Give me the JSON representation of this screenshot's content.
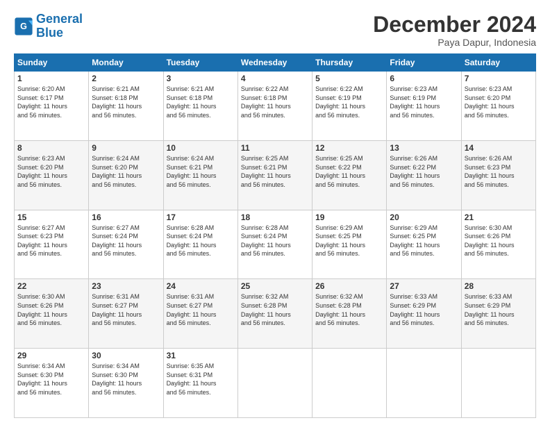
{
  "logo": {
    "line1": "General",
    "line2": "Blue"
  },
  "title": "December 2024",
  "subtitle": "Paya Dapur, Indonesia",
  "days_of_week": [
    "Sunday",
    "Monday",
    "Tuesday",
    "Wednesday",
    "Thursday",
    "Friday",
    "Saturday"
  ],
  "weeks": [
    [
      {
        "day": 1,
        "sunrise": "6:20 AM",
        "sunset": "6:17 PM",
        "daylight": "11 hours and 56 minutes."
      },
      {
        "day": 2,
        "sunrise": "6:21 AM",
        "sunset": "6:18 PM",
        "daylight": "11 hours and 56 minutes."
      },
      {
        "day": 3,
        "sunrise": "6:21 AM",
        "sunset": "6:18 PM",
        "daylight": "11 hours and 56 minutes."
      },
      {
        "day": 4,
        "sunrise": "6:22 AM",
        "sunset": "6:18 PM",
        "daylight": "11 hours and 56 minutes."
      },
      {
        "day": 5,
        "sunrise": "6:22 AM",
        "sunset": "6:19 PM",
        "daylight": "11 hours and 56 minutes."
      },
      {
        "day": 6,
        "sunrise": "6:23 AM",
        "sunset": "6:19 PM",
        "daylight": "11 hours and 56 minutes."
      },
      {
        "day": 7,
        "sunrise": "6:23 AM",
        "sunset": "6:20 PM",
        "daylight": "11 hours and 56 minutes."
      }
    ],
    [
      {
        "day": 8,
        "sunrise": "6:23 AM",
        "sunset": "6:20 PM",
        "daylight": "11 hours and 56 minutes."
      },
      {
        "day": 9,
        "sunrise": "6:24 AM",
        "sunset": "6:20 PM",
        "daylight": "11 hours and 56 minutes."
      },
      {
        "day": 10,
        "sunrise": "6:24 AM",
        "sunset": "6:21 PM",
        "daylight": "11 hours and 56 minutes."
      },
      {
        "day": 11,
        "sunrise": "6:25 AM",
        "sunset": "6:21 PM",
        "daylight": "11 hours and 56 minutes."
      },
      {
        "day": 12,
        "sunrise": "6:25 AM",
        "sunset": "6:22 PM",
        "daylight": "11 hours and 56 minutes."
      },
      {
        "day": 13,
        "sunrise": "6:26 AM",
        "sunset": "6:22 PM",
        "daylight": "11 hours and 56 minutes."
      },
      {
        "day": 14,
        "sunrise": "6:26 AM",
        "sunset": "6:23 PM",
        "daylight": "11 hours and 56 minutes."
      }
    ],
    [
      {
        "day": 15,
        "sunrise": "6:27 AM",
        "sunset": "6:23 PM",
        "daylight": "11 hours and 56 minutes."
      },
      {
        "day": 16,
        "sunrise": "6:27 AM",
        "sunset": "6:24 PM",
        "daylight": "11 hours and 56 minutes."
      },
      {
        "day": 17,
        "sunrise": "6:28 AM",
        "sunset": "6:24 PM",
        "daylight": "11 hours and 56 minutes."
      },
      {
        "day": 18,
        "sunrise": "6:28 AM",
        "sunset": "6:24 PM",
        "daylight": "11 hours and 56 minutes."
      },
      {
        "day": 19,
        "sunrise": "6:29 AM",
        "sunset": "6:25 PM",
        "daylight": "11 hours and 56 minutes."
      },
      {
        "day": 20,
        "sunrise": "6:29 AM",
        "sunset": "6:25 PM",
        "daylight": "11 hours and 56 minutes."
      },
      {
        "day": 21,
        "sunrise": "6:30 AM",
        "sunset": "6:26 PM",
        "daylight": "11 hours and 56 minutes."
      }
    ],
    [
      {
        "day": 22,
        "sunrise": "6:30 AM",
        "sunset": "6:26 PM",
        "daylight": "11 hours and 56 minutes."
      },
      {
        "day": 23,
        "sunrise": "6:31 AM",
        "sunset": "6:27 PM",
        "daylight": "11 hours and 56 minutes."
      },
      {
        "day": 24,
        "sunrise": "6:31 AM",
        "sunset": "6:27 PM",
        "daylight": "11 hours and 56 minutes."
      },
      {
        "day": 25,
        "sunrise": "6:32 AM",
        "sunset": "6:28 PM",
        "daylight": "11 hours and 56 minutes."
      },
      {
        "day": 26,
        "sunrise": "6:32 AM",
        "sunset": "6:28 PM",
        "daylight": "11 hours and 56 minutes."
      },
      {
        "day": 27,
        "sunrise": "6:33 AM",
        "sunset": "6:29 PM",
        "daylight": "11 hours and 56 minutes."
      },
      {
        "day": 28,
        "sunrise": "6:33 AM",
        "sunset": "6:29 PM",
        "daylight": "11 hours and 56 minutes."
      }
    ],
    [
      {
        "day": 29,
        "sunrise": "6:34 AM",
        "sunset": "6:30 PM",
        "daylight": "11 hours and 56 minutes."
      },
      {
        "day": 30,
        "sunrise": "6:34 AM",
        "sunset": "6:30 PM",
        "daylight": "11 hours and 56 minutes."
      },
      {
        "day": 31,
        "sunrise": "6:35 AM",
        "sunset": "6:31 PM",
        "daylight": "11 hours and 56 minutes."
      },
      null,
      null,
      null,
      null
    ]
  ]
}
